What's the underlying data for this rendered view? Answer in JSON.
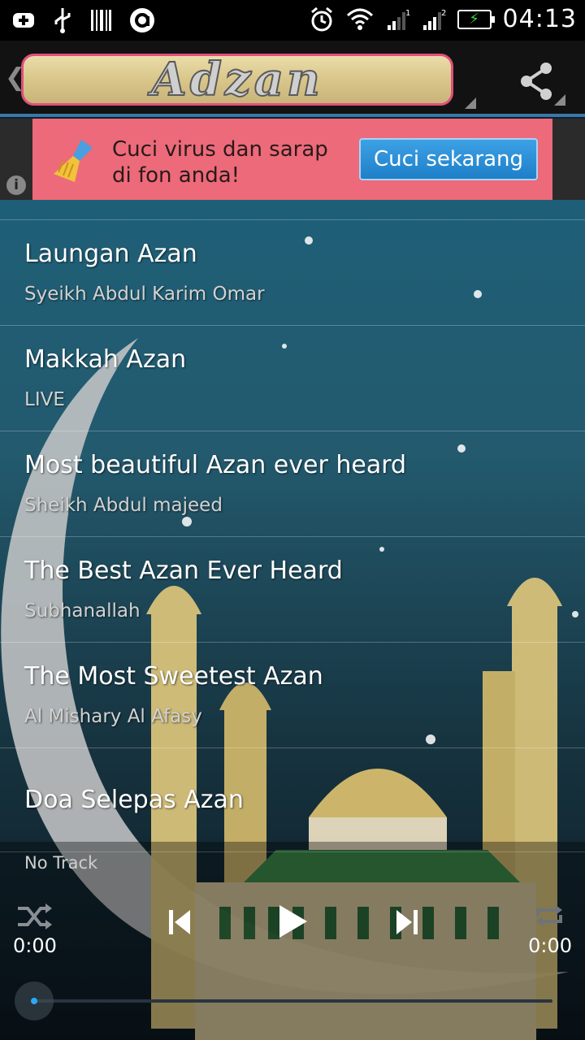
{
  "status_bar": {
    "time": "04:13",
    "left_icons": [
      "plus-circle-icon",
      "usb-icon",
      "barcode-icon",
      "circle-a-icon"
    ],
    "right_icons": [
      "alarm-icon",
      "wifi-icon",
      "signal-1-icon",
      "signal-2-icon",
      "battery-charging-icon"
    ],
    "signal_labels": [
      "1",
      "2"
    ]
  },
  "action_bar": {
    "app_title": "Adzan",
    "share_icon": "share-icon"
  },
  "ad": {
    "text_line1": "Cuci virus dan sarap",
    "text_line2": "di fon anda!",
    "button_label": "Cuci sekarang",
    "info_label": "i",
    "button_color": "#1e7fc8",
    "banner_color": "#ec6a7a"
  },
  "tracks": [
    {
      "title": "Laungan Azan",
      "subtitle": "Syeikh Abdul Karim Omar"
    },
    {
      "title": "Makkah Azan",
      "subtitle": "LIVE"
    },
    {
      "title": "Most beautiful Azan ever heard",
      "subtitle": "Sheikh Abdul majeed"
    },
    {
      "title": "The Best Azan Ever Heard",
      "subtitle": "Subhanallah"
    },
    {
      "title": "The Most Sweetest Azan",
      "subtitle": "Al Mishary Al Afasy"
    },
    {
      "title": "Doa Selepas Azan",
      "subtitle": ""
    }
  ],
  "player": {
    "now_playing": "No Track",
    "elapsed": "0:00",
    "duration": "0:00",
    "progress": 0,
    "accent": "#2aa8ff"
  }
}
